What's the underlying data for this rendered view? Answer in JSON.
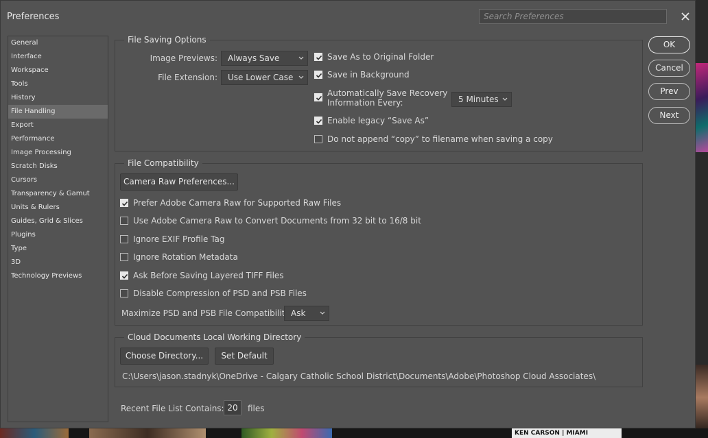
{
  "window": {
    "title": "Preferences"
  },
  "search": {
    "placeholder": "Search Preferences"
  },
  "sidebar": {
    "items": [
      "General",
      "Interface",
      "Workspace",
      "Tools",
      "History",
      "File Handling",
      "Export",
      "Performance",
      "Image Processing",
      "Scratch Disks",
      "Cursors",
      "Transparency & Gamut",
      "Units & Rulers",
      "Guides, Grid & Slices",
      "Plugins",
      "Type",
      "3D",
      "Technology Previews"
    ],
    "selected": "File Handling"
  },
  "file_saving": {
    "title": "File Saving Options",
    "image_previews_label": "Image Previews:",
    "image_previews_value": "Always Save",
    "file_extension_label": "File Extension:",
    "file_extension_value": "Use Lower Case",
    "save_as_original": {
      "label": "Save As to Original Folder",
      "checked": true
    },
    "save_in_background": {
      "label": "Save in Background",
      "checked": true
    },
    "auto_save": {
      "label_line1": "Automatically Save Recovery",
      "label_line2": "Information Every:",
      "checked": true
    },
    "auto_save_interval": "5 Minutes",
    "legacy_save_as": {
      "label": "Enable legacy “Save As”",
      "checked": true
    },
    "no_copy_append": {
      "label": "Do not append “copy” to filename when saving a copy",
      "checked": false
    }
  },
  "file_compat": {
    "title": "File Compatibility",
    "camera_raw_button": "Camera Raw Preferences...",
    "options": [
      {
        "label": "Prefer Adobe Camera Raw for Supported Raw Files",
        "checked": true
      },
      {
        "label": "Use Adobe Camera Raw to Convert Documents from 32 bit to 16/8 bit",
        "checked": false
      },
      {
        "label": "Ignore EXIF Profile Tag",
        "checked": false
      },
      {
        "label": "Ignore Rotation Metadata",
        "checked": false
      },
      {
        "label": "Ask Before Saving Layered TIFF Files",
        "checked": true
      },
      {
        "label": "Disable Compression of PSD and PSB Files",
        "checked": false
      }
    ],
    "maximize_label": "Maximize PSD and PSB File Compatibility:",
    "maximize_value": "Ask"
  },
  "cloud": {
    "title": "Cloud Documents Local Working Directory",
    "choose_button": "Choose Directory...",
    "default_button": "Set Default",
    "path": "C:\\Users\\jason.stadnyk\\OneDrive - Calgary Catholic School District\\Documents\\Adobe\\Photoshop Cloud Associates\\"
  },
  "recent": {
    "label": "Recent File List Contains:",
    "value": "20",
    "suffix": "files"
  },
  "actions": {
    "ok": "OK",
    "cancel": "Cancel",
    "prev": "Prev",
    "next": "Next"
  },
  "background": {
    "thumb_caption": "KEN CARSON | MIAMI"
  },
  "colors": {
    "dialog_bg": "#535353",
    "selection_bg": "#6a6a6a",
    "text": "#d6d6d6"
  }
}
